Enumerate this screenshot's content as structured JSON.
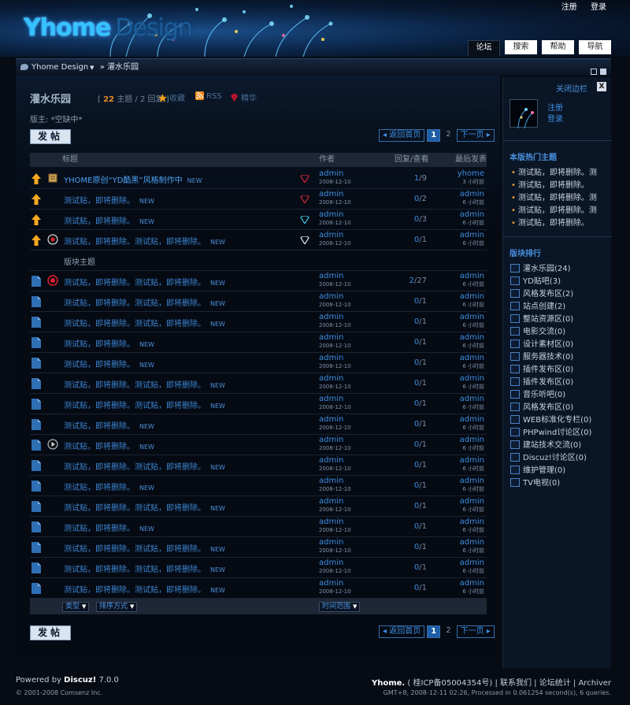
{
  "header": {
    "logo_primary": "Yhome",
    "logo_secondary": "Design",
    "top_links": [
      "注册",
      "登录"
    ],
    "nav_tabs": [
      {
        "label": "论坛",
        "active": true
      },
      {
        "label": "搜索",
        "active": false
      },
      {
        "label": "帮助",
        "active": false
      },
      {
        "label": "导航",
        "active": false
      }
    ]
  },
  "breadcrumb": {
    "root": "Yhome Design",
    "separator": "»",
    "current": "灌水乐园"
  },
  "forum": {
    "name": "灌水乐园",
    "stats_open": "[",
    "topics_count": "22",
    "topics_label": "主题",
    "stats_sep": "/",
    "replies": "2 回复",
    "stats_close": "]",
    "favorite_label": "收藏",
    "rss_label": "RSS",
    "digest_label": "精华",
    "moderator_label": "版主:",
    "moderator_value": "*空缺中*",
    "post_button": "发帖",
    "pager": {
      "back": "返回首页",
      "current": "1",
      "page2": "2",
      "next": "下一页"
    }
  },
  "table": {
    "headers": {
      "title": "标题",
      "author": "作者",
      "counts": "回复/查看",
      "last": "最后发表"
    },
    "section_label": "版块主题",
    "rows": [
      {
        "folder": "top",
        "type": "scroll",
        "title": "YHOME原创“YD酷黑”风格制作中",
        "new": "NEW",
        "diamond": "red",
        "author": "admin",
        "date": "2008-12-10",
        "replies": "1",
        "views": "9",
        "last_user": "yhome",
        "last_time": "3 小时前",
        "highlight": true
      },
      {
        "folder": "top",
        "type": "",
        "title": "测试贴，即将删除。",
        "new": "NEW",
        "diamond": "red",
        "author": "admin",
        "date": "2008-12-10",
        "replies": "0",
        "views": "2",
        "last_user": "admin",
        "last_time": "6 小时前"
      },
      {
        "folder": "top",
        "type": "",
        "title": "测试贴，即将删除。",
        "new": "NEW",
        "diamond": "cyan",
        "author": "admin",
        "date": "2008-12-10",
        "replies": "0",
        "views": "3",
        "last_user": "admin",
        "last_time": "6 小时前"
      },
      {
        "folder": "top",
        "type": "vote",
        "title": "测试贴，即将删除。测试贴，即将删除。",
        "new": "NEW",
        "diamond": "white",
        "author": "admin",
        "date": "2008-12-10",
        "replies": "0",
        "views": "1",
        "last_user": "admin",
        "last_time": "6 小时前"
      },
      {
        "section": true
      },
      {
        "folder": "normal",
        "type": "hot",
        "title": "测试贴，即将删除。测试贴，即将删除。",
        "new": "NEW",
        "diamond": "",
        "author": "admin",
        "date": "2008-12-10",
        "replies": "2",
        "views": "27",
        "last_user": "admin",
        "last_time": "6 小时前"
      },
      {
        "folder": "normal",
        "type": "",
        "title": "测试贴，即将删除。测试贴，即将删除。",
        "new": "NEW",
        "diamond": "",
        "author": "admin",
        "date": "2008-12-10",
        "replies": "0",
        "views": "1",
        "last_user": "admin",
        "last_time": "6 小时前"
      },
      {
        "folder": "normal",
        "type": "",
        "title": "测试贴，即将删除。测试贴，即将删除。",
        "new": "NEW",
        "diamond": "",
        "author": "admin",
        "date": "2008-12-10",
        "replies": "0",
        "views": "1",
        "last_user": "admin",
        "last_time": "6 小时前"
      },
      {
        "folder": "normal",
        "type": "",
        "title": "测试贴，即将删除。",
        "new": "NEW",
        "diamond": "",
        "author": "admin",
        "date": "2008-12-10",
        "replies": "0",
        "views": "1",
        "last_user": "admin",
        "last_time": "6 小时前"
      },
      {
        "folder": "normal",
        "type": "",
        "title": "测试贴，即将删除。",
        "new": "NEW",
        "diamond": "",
        "author": "admin",
        "date": "2008-12-10",
        "replies": "0",
        "views": "1",
        "last_user": "admin",
        "last_time": "6 小时前"
      },
      {
        "folder": "normal",
        "type": "",
        "title": "测试贴，即将删除。测试贴，即将删除。",
        "new": "NEW",
        "diamond": "",
        "author": "admin",
        "date": "2008-12-10",
        "replies": "0",
        "views": "1",
        "last_user": "admin",
        "last_time": "6 小时前"
      },
      {
        "folder": "normal",
        "type": "",
        "title": "测试贴，即将删除。测试贴，即将删除。",
        "new": "NEW",
        "diamond": "",
        "author": "admin",
        "date": "2008-12-10",
        "replies": "0",
        "views": "1",
        "last_user": "admin",
        "last_time": "6 小时前"
      },
      {
        "folder": "normal",
        "type": "",
        "title": "测试贴，即将删除。",
        "new": "NEW",
        "diamond": "",
        "author": "admin",
        "date": "2008-12-10",
        "replies": "0",
        "views": "1",
        "last_user": "admin",
        "last_time": "6 小时前"
      },
      {
        "folder": "normal",
        "type": "play",
        "title": "测试贴，即将删除。",
        "new": "NEW",
        "diamond": "",
        "author": "admin",
        "date": "2008-12-10",
        "replies": "0",
        "views": "1",
        "last_user": "admin",
        "last_time": "6 小时前"
      },
      {
        "folder": "normal",
        "type": "",
        "title": "测试贴，即将删除。测试贴，即将删除。",
        "new": "NEW",
        "diamond": "",
        "author": "admin",
        "date": "2008-12-10",
        "replies": "0",
        "views": "1",
        "last_user": "admin",
        "last_time": "6 小时前"
      },
      {
        "folder": "normal",
        "type": "",
        "title": "测试贴，即将删除。",
        "new": "NEW",
        "diamond": "",
        "author": "admin",
        "date": "2008-12-10",
        "replies": "0",
        "views": "1",
        "last_user": "admin",
        "last_time": "6 小时前"
      },
      {
        "folder": "normal",
        "type": "",
        "title": "测试贴，即将删除。测试贴，即将删除。",
        "new": "NEW",
        "diamond": "",
        "author": "admin",
        "date": "2008-12-10",
        "replies": "0",
        "views": "1",
        "last_user": "admin",
        "last_time": "6 小时前"
      },
      {
        "folder": "normal",
        "type": "",
        "title": "测试贴，即将删除。",
        "new": "NEW",
        "diamond": "",
        "author": "admin",
        "date": "2008-12-10",
        "replies": "0",
        "views": "1",
        "last_user": "admin",
        "last_time": "6 小时前"
      },
      {
        "folder": "normal",
        "type": "",
        "title": "测试贴，即将删除。测试贴，即将删除。",
        "new": "NEW",
        "diamond": "",
        "author": "admin",
        "date": "2008-12-10",
        "replies": "0",
        "views": "1",
        "last_user": "admin",
        "last_time": "6 小时前"
      },
      {
        "folder": "normal",
        "type": "",
        "title": "测试贴，即将删除。测试贴，即将删除。",
        "new": "NEW",
        "diamond": "",
        "author": "admin",
        "date": "2008-12-10",
        "replies": "0",
        "views": "1",
        "last_user": "admin",
        "last_time": "6 小时前"
      },
      {
        "folder": "normal",
        "type": "",
        "title": "测试贴，即将删除。测试贴，即将删除。",
        "new": "NEW",
        "diamond": "",
        "author": "admin",
        "date": "2008-12-10",
        "replies": "0",
        "views": "1",
        "last_user": "admin",
        "last_time": "6 小时前"
      }
    ],
    "filters": {
      "type": "类型",
      "sort": "排序方式",
      "range": "时间范围"
    }
  },
  "sidebar": {
    "close_label": "关闭边栏",
    "close_x": "X",
    "user_links": [
      "注册",
      "登录"
    ],
    "hot_title": "本版热门主题",
    "hot_topics": [
      "测试贴，即将删除。测",
      "测试贴，即将删除。",
      "测试贴，即将删除。测",
      "测试贴，即将删除。测",
      "测试贴，即将删除。"
    ],
    "rank_title": "版块排行",
    "rankings": [
      "灌水乐园(24)",
      "YD贴吧(3)",
      "风格发布区(2)",
      "站点创建(2)",
      "整站资源区(0)",
      "电影交流(0)",
      "设计素材区(0)",
      "服务器技术(0)",
      "插件发布区(0)",
      "插件发布区(0)",
      "音乐听吧(0)",
      "风格发布区(0)",
      "WEB标准化专栏(0)",
      "PHPwind讨论区(0)",
      "建站技术交流(0)",
      "Discuz!讨论区(0)",
      "维护管理(0)",
      "TV电视(0)"
    ]
  },
  "footer": {
    "powered_prefix": "Powered by",
    "powered_product": "Discuz!",
    "powered_version": "7.0.0",
    "copyright": "© 2001-2008 Comsenz Inc.",
    "site": "Yhome.",
    "icp": "( 桂ICP备05004354号)",
    "links": [
      "联系我们",
      "论坛统计",
      "Archiver"
    ],
    "gmt": "GMT+8, 2008-12-11 02:26, Processed in 0.061254 second(s), 6 queries."
  },
  "colors": {
    "background": "#060b14",
    "link": "#3d8de0",
    "accent_orange": "#e58a1f",
    "header_bar": "#1d2735"
  }
}
